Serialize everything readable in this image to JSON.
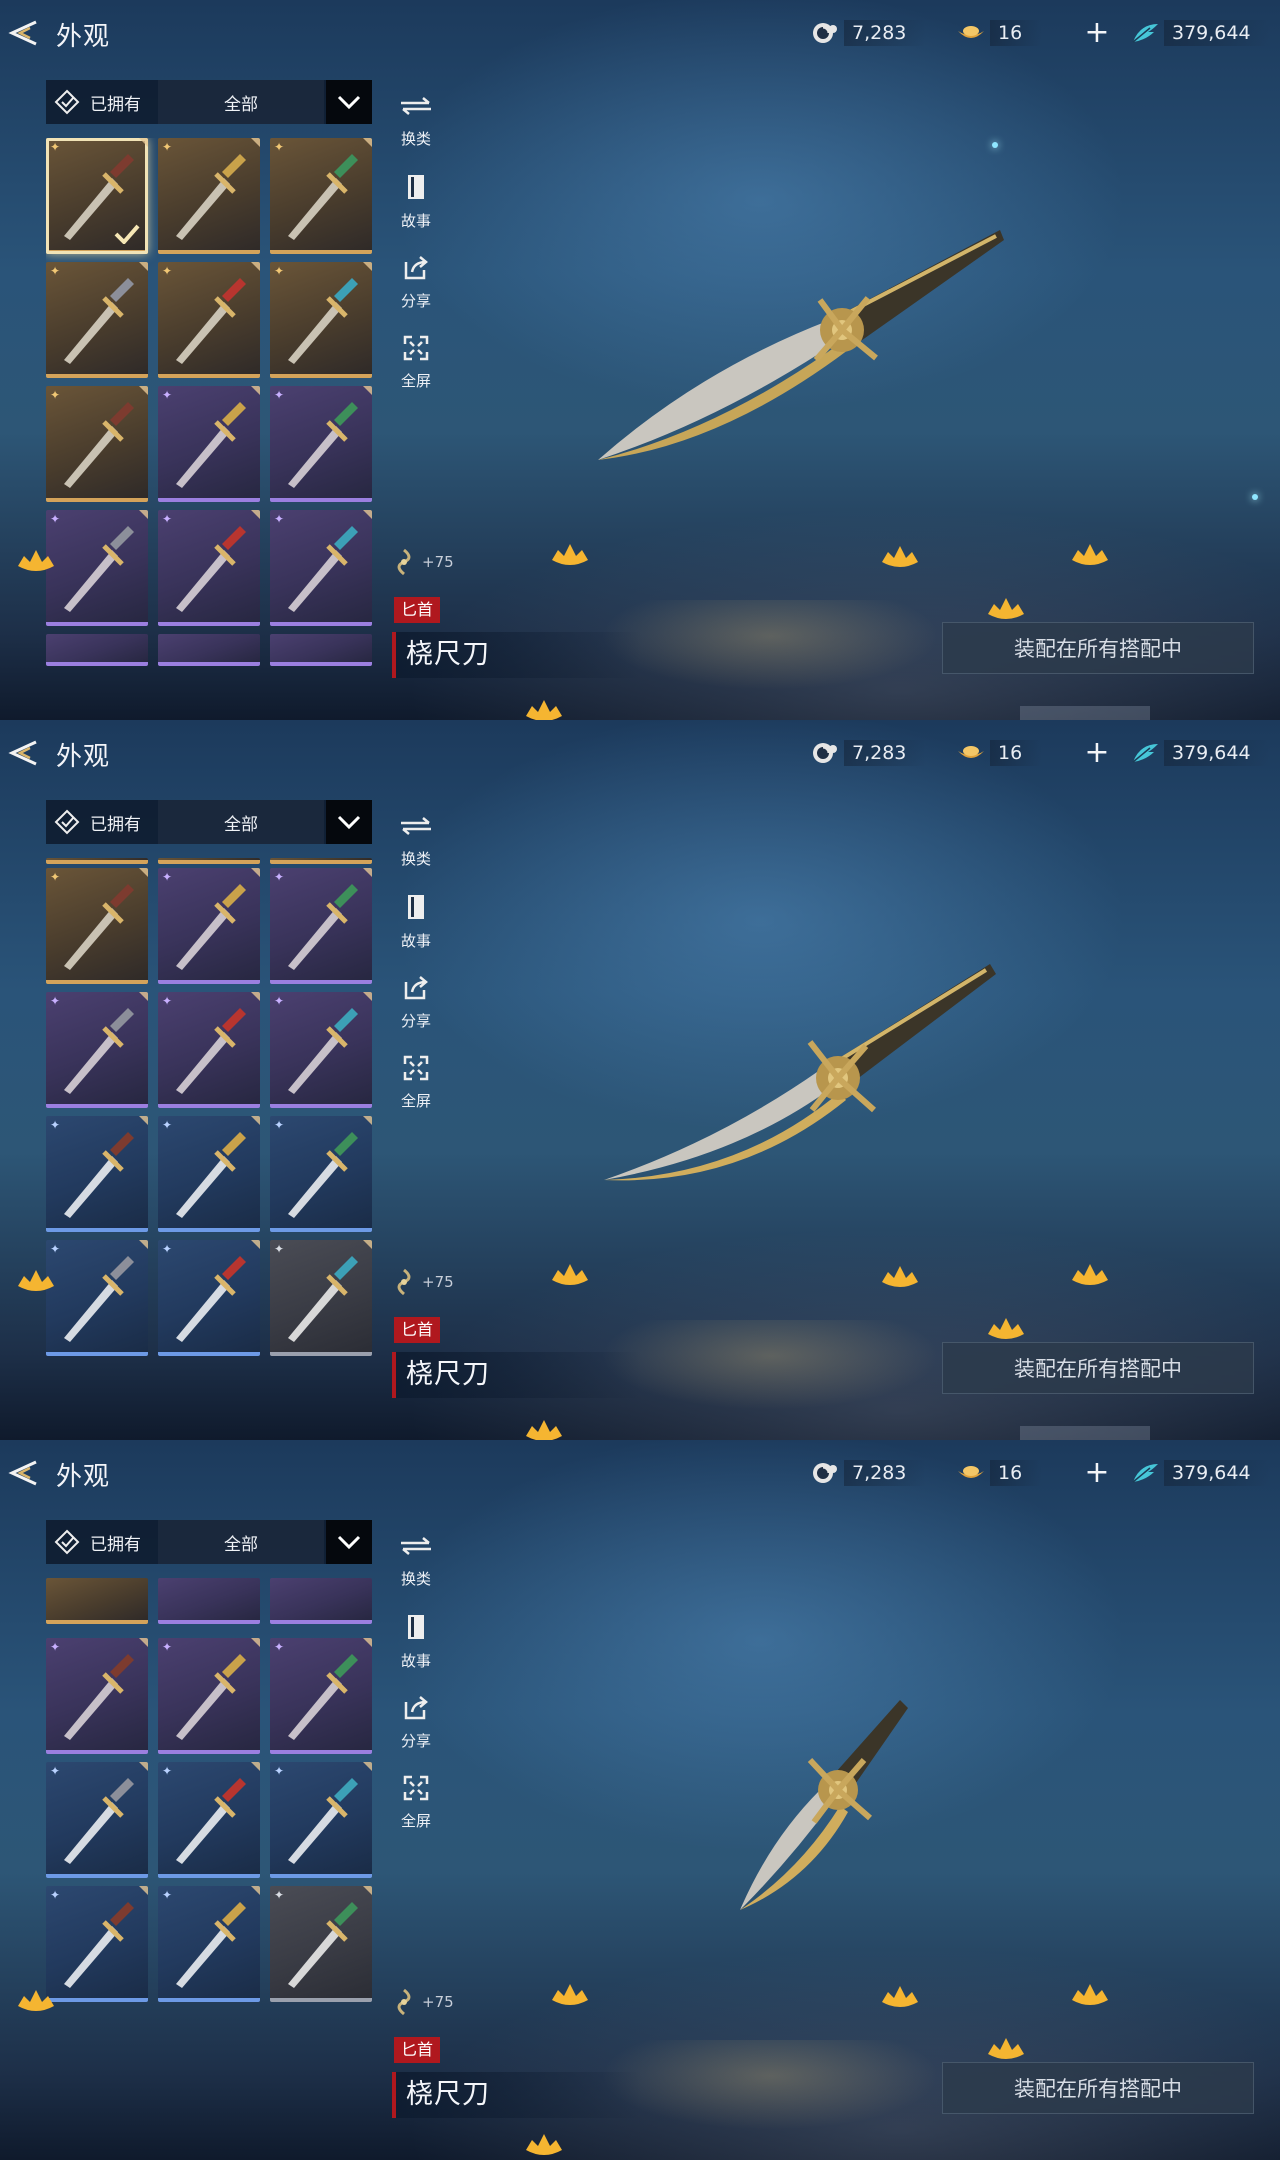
{
  "header": {
    "title": "外观",
    "currencies": [
      {
        "icon": "coin-spiral-icon",
        "value": "7,283"
      },
      {
        "icon": "gold-ingot-icon",
        "value": "16"
      },
      {
        "icon": "jade-feather-icon",
        "value": "379,644"
      }
    ],
    "plus_label": "+"
  },
  "filter": {
    "owned_label": "已拥有",
    "category_label": "全部"
  },
  "side_actions": [
    {
      "id": "change-type",
      "icon": "swap-icon",
      "label": "换类"
    },
    {
      "id": "story",
      "icon": "book-icon",
      "label": "故事"
    },
    {
      "id": "share",
      "icon": "share-icon",
      "label": "分享"
    },
    {
      "id": "fullscreen",
      "icon": "fullscreen-icon",
      "label": "全屏"
    }
  ],
  "item": {
    "stars": "+75",
    "type_tag": "匕首",
    "name": "桡尺刀",
    "equip_label": "装配在所有搭配中"
  },
  "palette": {
    "gold": "#d4a35a",
    "purple": "#9b7fe0",
    "blue": "#6d9ae6",
    "grey": "#9aa0ad",
    "tag_red": "#b0181e"
  },
  "panels": [
    {
      "id": "panel-1",
      "selected_index": 0,
      "rows": [
        [
          "gold",
          "gold",
          "gold"
        ],
        [
          "gold",
          "gold",
          "gold"
        ],
        [
          "gold",
          "purple",
          "purple"
        ],
        [
          "purple",
          "purple",
          "purple"
        ]
      ],
      "partial_bottom": [
        "purple",
        "purple",
        "purple"
      ]
    },
    {
      "id": "panel-2",
      "partial_top": [
        "gold",
        "gold",
        "gold"
      ],
      "rows": [
        [
          "gold",
          "purple",
          "purple"
        ],
        [
          "purple",
          "purple",
          "purple"
        ],
        [
          "blue",
          "blue",
          "blue"
        ],
        [
          "blue",
          "blue",
          "grey"
        ]
      ]
    },
    {
      "id": "panel-3",
      "partial_top_rows": [
        [
          "gold",
          "purple",
          "purple"
        ]
      ],
      "rows": [
        [
          "purple",
          "purple",
          "purple"
        ],
        [
          "blue",
          "blue",
          "blue"
        ],
        [
          "blue",
          "blue",
          "grey"
        ]
      ]
    }
  ]
}
